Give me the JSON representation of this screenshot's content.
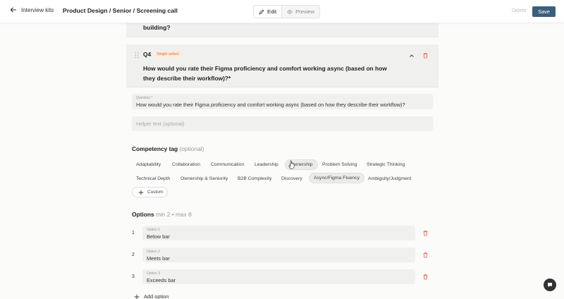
{
  "header": {
    "back_label": "Interview kits",
    "breadcrumb": "Product Design / Senior / Screening call",
    "edit_label": "Edit",
    "preview_label": "Preview",
    "delete_label": "Delete",
    "save_label": "Save"
  },
  "previous_card": {
    "text_tail": "building?"
  },
  "question": {
    "number": "Q4",
    "type_badge": "Single select",
    "title": "How would you rate their Figma proficiency and comfort working async (based on how they describe their workflow)?*",
    "field_label": "Question *",
    "field_value": "How would you rate their Figma proficiency and comfort working async (based on how they describe their workflow)?",
    "helper_placeholder": "Helper text (optional)"
  },
  "competency": {
    "heading": "Competency tag",
    "heading_optional": "(optional)",
    "tags_row1": [
      "Adaptability",
      "Collaboration",
      "Communication",
      "Leadership",
      "Ownership",
      "Problem Solving",
      "Strategic Thinking"
    ],
    "tags_row2": [
      "Technical Depth",
      "Ownership & Seniority",
      "B2B Complexity",
      "Discovery",
      "Async/Figma Fluency",
      "Ambiguity/Judgment"
    ],
    "custom_label": "Custom"
  },
  "options": {
    "heading": "Options",
    "constraint": "min 2 • max 8",
    "items": [
      {
        "index": "1",
        "label": "Option 1",
        "value": "Below bar"
      },
      {
        "index": "2",
        "label": "Option 2",
        "value": "Meets bar"
      },
      {
        "index": "3",
        "label": "Option 3",
        "value": "Exceeds bar"
      }
    ],
    "add_label": "Add option"
  },
  "colors": {
    "accent": "#3a5f7d",
    "badge_text": "#e0702a",
    "badge_bg": "#fdebd9",
    "trash": "#e05a4a"
  },
  "icons": {
    "back": "arrow-left-icon",
    "edit": "pencil-icon",
    "preview": "eye-icon",
    "drag": "drag-handle-icon",
    "collapse": "chevron-up-icon",
    "delete": "trash-icon",
    "add": "plus-icon",
    "chat": "chat-bubble-icon"
  }
}
